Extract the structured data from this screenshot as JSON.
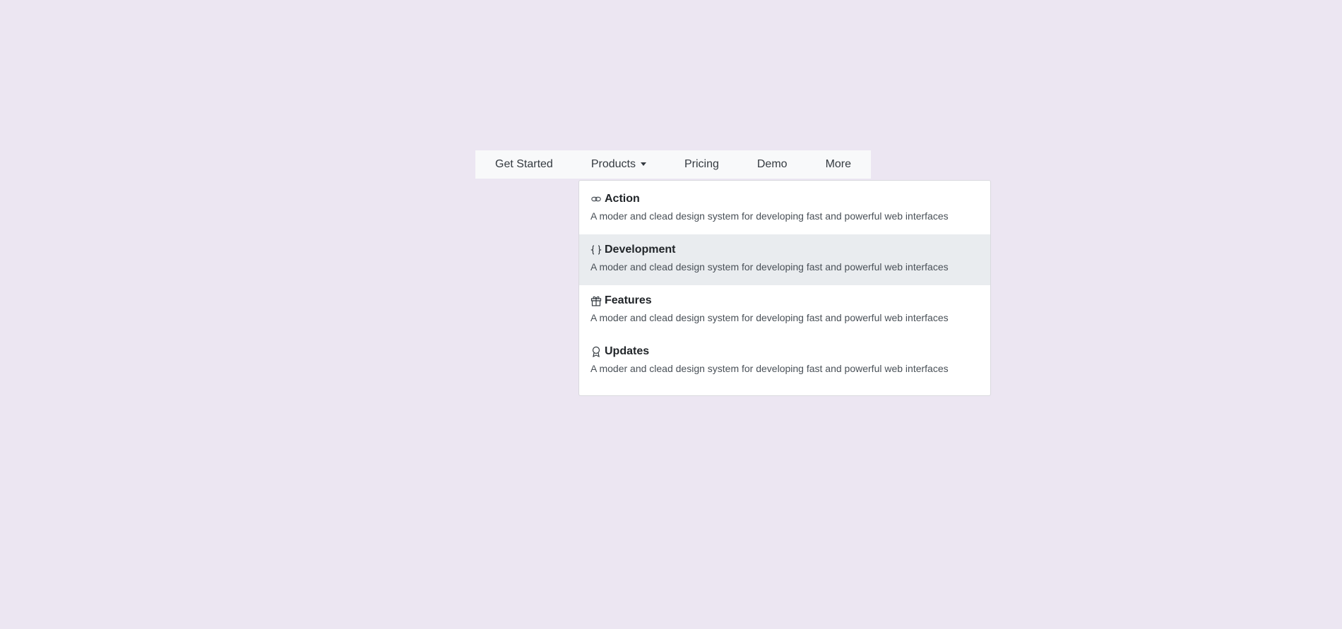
{
  "nav": {
    "items": [
      {
        "label": "Get Started"
      },
      {
        "label": "Products"
      },
      {
        "label": "Pricing"
      },
      {
        "label": "Demo"
      },
      {
        "label": "More"
      }
    ]
  },
  "dropdown": {
    "items": [
      {
        "icon": "link-icon",
        "title": "Action",
        "description": "A moder and clead design system for developing fast and powerful web interfaces"
      },
      {
        "icon": "braces-icon",
        "title": "Development",
        "description": "A moder and clead design system for developing fast and powerful web interfaces"
      },
      {
        "icon": "gift-icon",
        "title": "Features",
        "description": "A moder and clead design system for developing fast and powerful web interfaces"
      },
      {
        "icon": "award-icon",
        "title": "Updates",
        "description": "A moder and clead design system for developing fast and powerful web interfaces"
      }
    ]
  },
  "colors": {
    "background": "#ece6f2",
    "navbar": "#f8f9fa",
    "dropdown_active": "#e9ecef"
  }
}
